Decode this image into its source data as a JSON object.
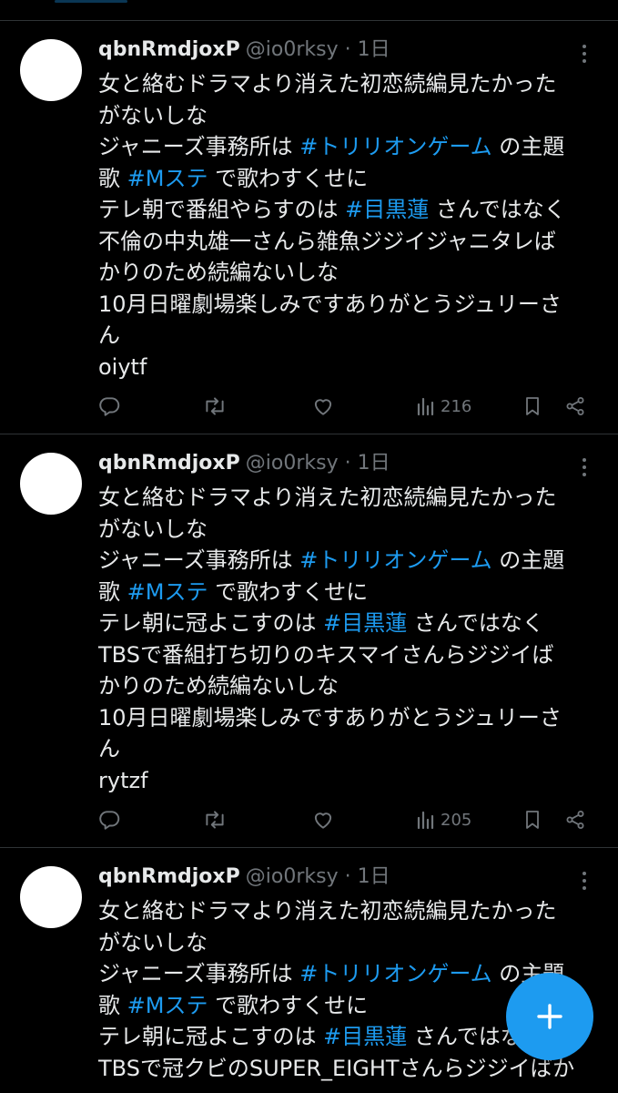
{
  "tweets": [
    {
      "name": "qbnRmdjoxP",
      "handle_time": "@io0rksy · 1日",
      "lines": [
        [
          {
            "t": "女と絡むドラマより消えた初恋続編見たかった",
            "h": false
          }
        ],
        [
          {
            "t": "がないしな",
            "h": false
          }
        ],
        [
          {
            "t": "ジャニーズ事務所は ",
            "h": false
          },
          {
            "t": "#トリリオンゲーム",
            "h": true
          },
          {
            "t": " の主題",
            "h": false
          }
        ],
        [
          {
            "t": "歌 ",
            "h": false
          },
          {
            "t": "#Mステ",
            "h": true
          },
          {
            "t": " で歌わすくせに",
            "h": false
          }
        ],
        [
          {
            "t": "テレ朝で番組やらすのは ",
            "h": false
          },
          {
            "t": "#目黒蓮",
            "h": true
          },
          {
            "t": " さんではなく",
            "h": false
          }
        ],
        [
          {
            "t": "不倫の中丸雄一さんら雑魚ジジイジャニタレば",
            "h": false
          }
        ],
        [
          {
            "t": "かりのため続編ないしな",
            "h": false
          }
        ],
        [
          {
            "t": "10月日曜劇場楽しみですありがとうジュリーさ",
            "h": false
          }
        ],
        [
          {
            "t": "ん",
            "h": false
          }
        ],
        [
          {
            "t": "oiytf",
            "h": false
          }
        ]
      ],
      "views": "216"
    },
    {
      "name": "qbnRmdjoxP",
      "handle_time": "@io0rksy · 1日",
      "lines": [
        [
          {
            "t": "女と絡むドラマより消えた初恋続編見たかった",
            "h": false
          }
        ],
        [
          {
            "t": "がないしな",
            "h": false
          }
        ],
        [
          {
            "t": "ジャニーズ事務所は ",
            "h": false
          },
          {
            "t": "#トリリオンゲーム",
            "h": true
          },
          {
            "t": " の主題",
            "h": false
          }
        ],
        [
          {
            "t": "歌 ",
            "h": false
          },
          {
            "t": "#Mステ",
            "h": true
          },
          {
            "t": " で歌わすくせに",
            "h": false
          }
        ],
        [
          {
            "t": "テレ朝に冠よこすのは ",
            "h": false
          },
          {
            "t": "#目黒蓮",
            "h": true
          },
          {
            "t": " さんではなく",
            "h": false
          }
        ],
        [
          {
            "t": "TBSで番組打ち切りのキスマイさんらジジイば",
            "h": false
          }
        ],
        [
          {
            "t": "かりのため続編ないしな",
            "h": false
          }
        ],
        [
          {
            "t": "10月日曜劇場楽しみですありがとうジュリーさ",
            "h": false
          }
        ],
        [
          {
            "t": "ん",
            "h": false
          }
        ],
        [
          {
            "t": "rytzf",
            "h": false
          }
        ]
      ],
      "views": "205"
    },
    {
      "name": "qbnRmdjoxP",
      "handle_time": "@io0rksy · 1日",
      "lines": [
        [
          {
            "t": "女と絡むドラマより消えた初恋続編見たかった",
            "h": false
          }
        ],
        [
          {
            "t": "がないしな",
            "h": false
          }
        ],
        [
          {
            "t": "ジャニーズ事務所は ",
            "h": false
          },
          {
            "t": "#トリリオンゲーム",
            "h": true
          },
          {
            "t": " の主題",
            "h": false
          }
        ],
        [
          {
            "t": "歌 ",
            "h": false
          },
          {
            "t": "#Mステ",
            "h": true
          },
          {
            "t": " で歌わすくせに",
            "h": false
          }
        ],
        [
          {
            "t": "テレ朝に冠よこすのは ",
            "h": false
          },
          {
            "t": "#目黒蓮",
            "h": true
          },
          {
            "t": " さんではなく",
            "h": false
          }
        ],
        [
          {
            "t": "TBSで冠クビのSUPER_EIGHTさんらジジイばか",
            "h": false
          }
        ]
      ],
      "views": ""
    }
  ],
  "fab": {
    "icon": "plus-icon",
    "color": "#1d9bf0"
  },
  "colors": {
    "hashtag": "#1d9bf0",
    "muted": "#71767b",
    "text": "#e7e9ea",
    "background": "#000000"
  }
}
